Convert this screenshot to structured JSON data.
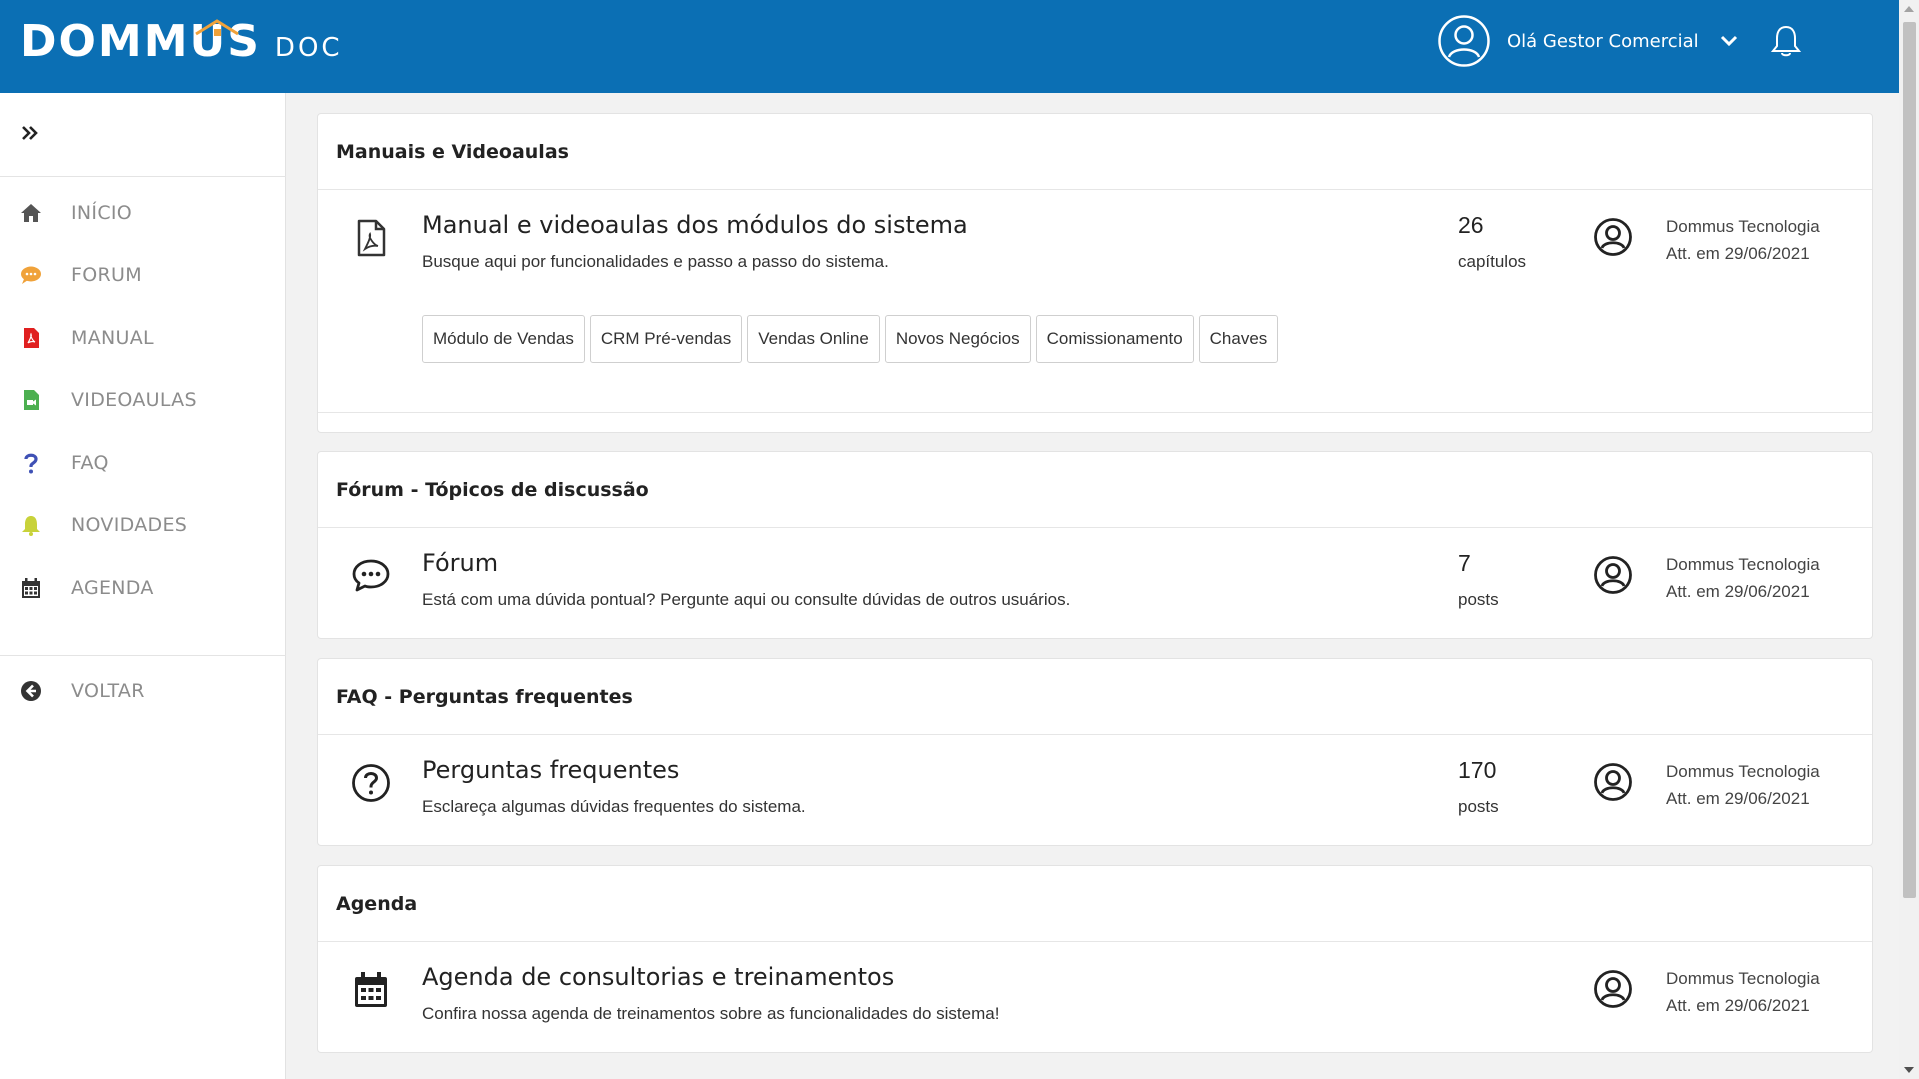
{
  "header": {
    "logo_main": "DOMMUS",
    "logo_sub": "DOC",
    "greeting": "Olá Gestor Comercial",
    "brand_color": "#0b6fb4",
    "accent_color": "#f0a23a"
  },
  "sidebar": {
    "items": [
      {
        "label": "INÍCIO",
        "icon": "home-icon",
        "color": "#555555"
      },
      {
        "label": "FORUM",
        "icon": "chat-icon",
        "color": "#f0a23a"
      },
      {
        "label": "MANUAL",
        "icon": "pdf-file-icon",
        "color": "#e02020"
      },
      {
        "label": "VIDEOAULAS",
        "icon": "video-file-icon",
        "color": "#4caf50"
      },
      {
        "label": "FAQ",
        "icon": "question-icon",
        "color": "#3f51b5"
      },
      {
        "label": "NOVIDADES",
        "icon": "bell-icon",
        "color": "#c8d23a"
      },
      {
        "label": "AGENDA",
        "icon": "calendar-icon",
        "color": "#333333"
      }
    ],
    "back_label": "VOLTAR"
  },
  "cards": {
    "manuals": {
      "header": "Manuais e Videoaulas",
      "title": "Manual e videoaulas dos módulos do sistema",
      "desc": "Busque aqui por funcionalidades e passo a passo do sistema.",
      "count": "26",
      "unit": "capítulos",
      "author": "Dommus Tecnologia",
      "date": "Att. em 29/06/2021",
      "chips": [
        "Módulo de Vendas",
        "CRM Pré-vendas",
        "Vendas Online",
        "Novos Negócios",
        "Comissionamento",
        "Chaves"
      ]
    },
    "forum": {
      "header": "Fórum - Tópicos de discussão",
      "title": "Fórum",
      "desc": "Está com uma dúvida pontual? Pergunte aqui ou consulte dúvidas de outros usuários.",
      "count": "7",
      "unit": "posts",
      "author": "Dommus Tecnologia",
      "date": "Att. em 29/06/2021"
    },
    "faq": {
      "header": "FAQ - Perguntas frequentes",
      "title": "Perguntas frequentes",
      "desc": "Esclareça algumas dúvidas frequentes do sistema.",
      "count": "170",
      "unit": "posts",
      "author": "Dommus Tecnologia",
      "date": "Att. em 29/06/2021"
    },
    "agenda": {
      "header": "Agenda",
      "title": "Agenda de consultorias e treinamentos",
      "desc": "Confira nossa agenda de treinamentos sobre as funcionalidades do sistema!",
      "author": "Dommus Tecnologia",
      "date": "Att. em 29/06/2021"
    }
  }
}
